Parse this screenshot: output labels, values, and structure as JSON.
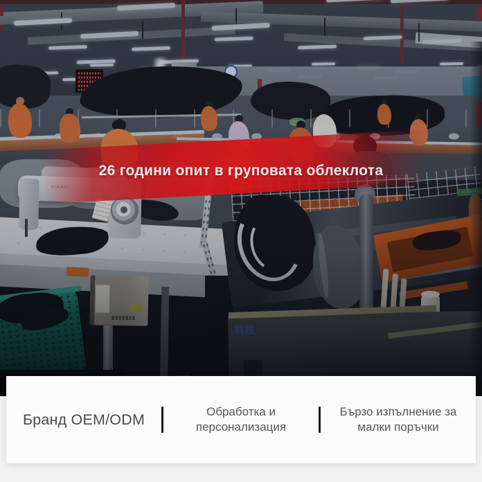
{
  "hero_banner": {
    "text": "26 години опит в груповата облеклота",
    "accent_color": "#cf1318",
    "text_color": "#f2e9e9"
  },
  "features": {
    "items": [
      {
        "label": "Бранд OEM/ODM"
      },
      {
        "label": "Обработка и персонализация"
      },
      {
        "label": "Бързо изпълнение за малки поръчки"
      }
    ],
    "divider_color": "#17191c",
    "text_color": "#4c4c4c"
  },
  "photo": {
    "machine_brand": "HIKARI",
    "machine_text": "科技"
  }
}
